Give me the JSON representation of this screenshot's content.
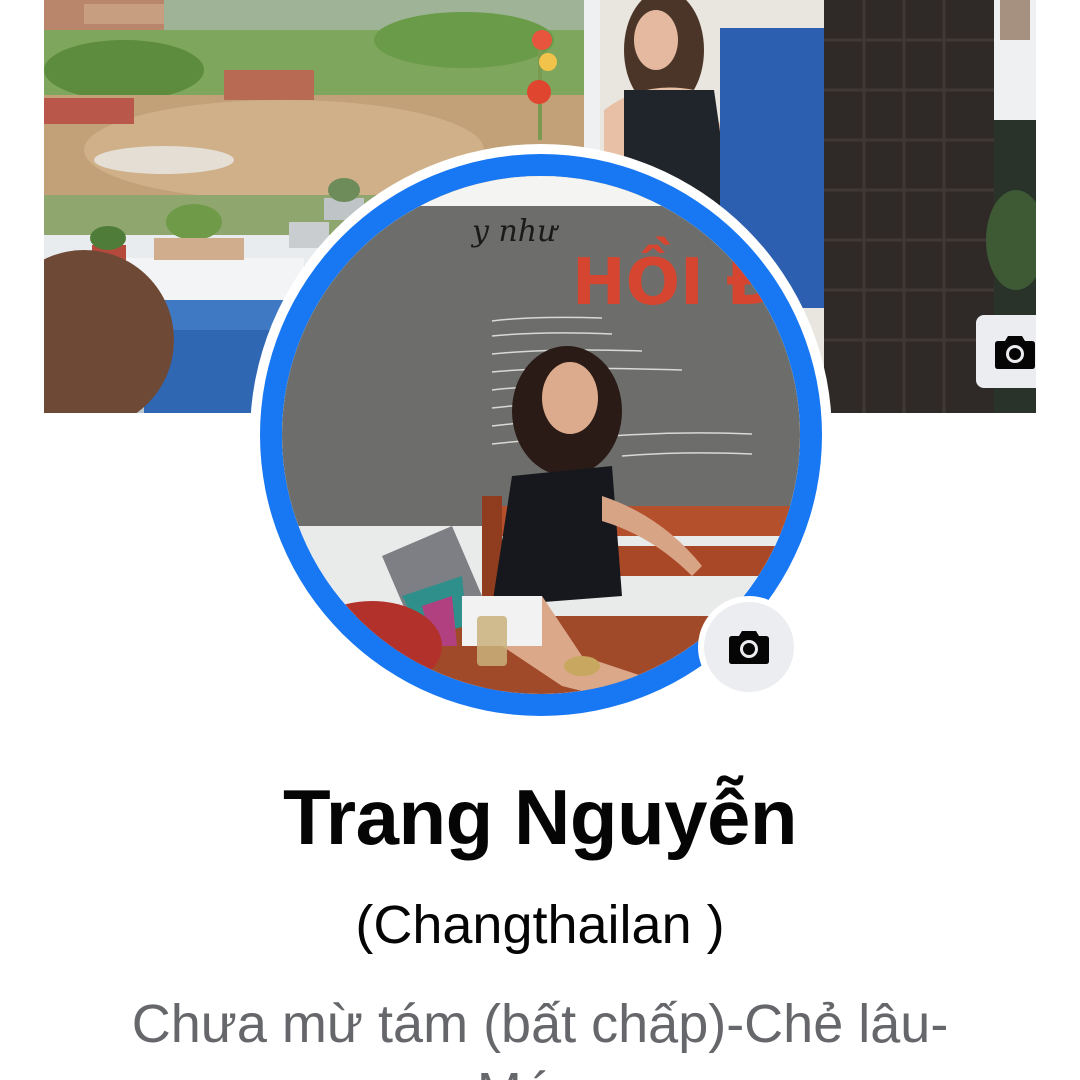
{
  "profile": {
    "name": "Trang Nguyễn",
    "alternate_name": "(Changthailan )",
    "bio": "Chưa mừ tám (bất chấp)-Chẻ lâu- Mứ..."
  },
  "cover_photo": {
    "camera_icon": "camera-icon"
  },
  "profile_picture": {
    "camera_icon": "camera-icon"
  },
  "colors": {
    "accent": "#1877f2",
    "text_primary": "#050505",
    "text_secondary": "#65676b",
    "icon_bg": "#ebedf0"
  }
}
